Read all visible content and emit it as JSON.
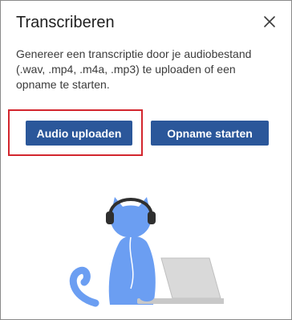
{
  "panel": {
    "title": "Transcriberen",
    "description": "Genereer een transcriptie door je audiobestand (.wav, .mp4, .m4a, .mp3) te uploaden of een opname te starten.",
    "buttons": {
      "upload_label": "Audio uploaden",
      "record_label": "Opname starten"
    }
  },
  "colors": {
    "button_bg": "#2b579a",
    "highlight_border": "#d3262e",
    "illustration_cat": "#6b9ef2",
    "illustration_laptop": "#d9d9d9"
  },
  "icons": {
    "close": "close-icon",
    "illustration": "cat-with-headphones-laptop"
  }
}
